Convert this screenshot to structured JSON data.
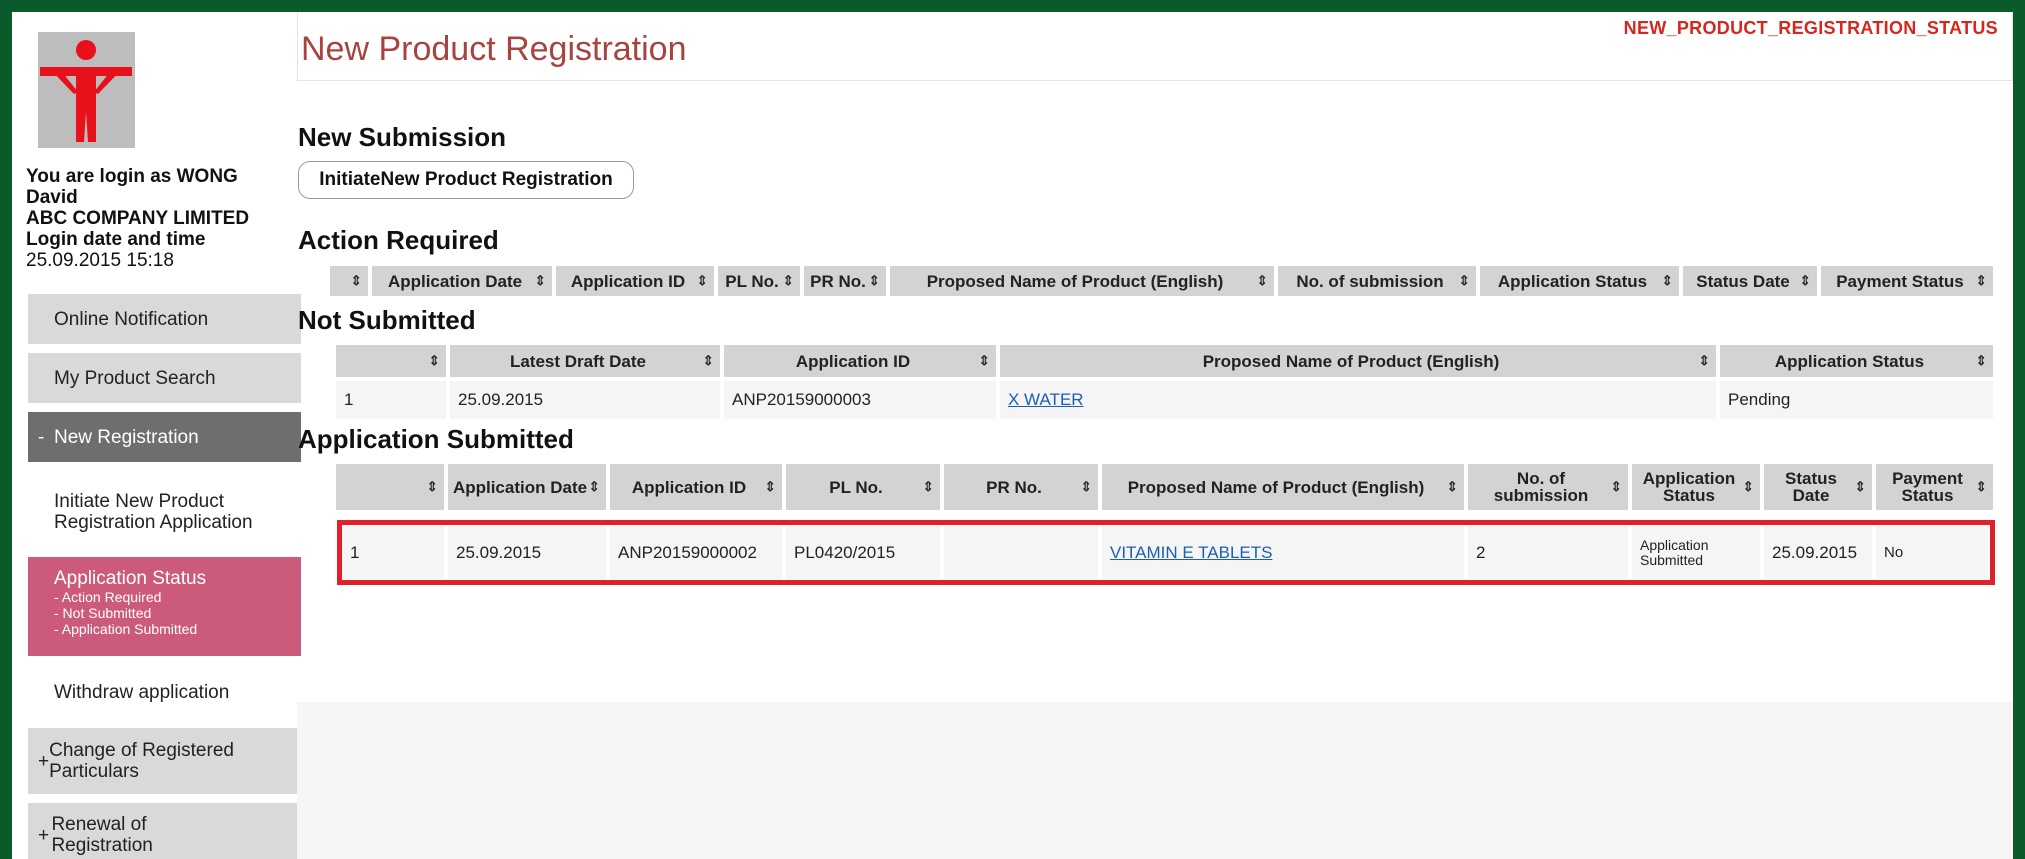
{
  "header": {
    "title": "New Product Registration",
    "code": "NEW_PRODUCT_REGISTRATION_STATUS"
  },
  "user": {
    "login_line1": "You are login as WONG",
    "login_line2": "David",
    "company": "ABC COMPANY LIMITED",
    "datetime_label": "Login date and time",
    "datetime": "25.09.2015 15:18"
  },
  "sidebar": {
    "online_notification": "Online Notification",
    "product_search": "My Product Search",
    "new_registration": "New Registration",
    "initiate_application": "Initiate New Product Registration Application",
    "application_status": "Application Status",
    "status_sub": [
      "- Action Required",
      "- Not Submitted",
      "- Application Submitted"
    ],
    "withdraw": "Withdraw application",
    "change_particulars": "Change of Registered Particulars",
    "renewal": "Renewal of Registration"
  },
  "new_submission": {
    "title": "New Submission",
    "button": "InitiateNew Product Registration"
  },
  "action_required": {
    "title": "Action Required",
    "headers": [
      "",
      "Application Date",
      "Application ID",
      "PL No.",
      "PR No.",
      "Proposed Name of Product (English)",
      "No. of submission",
      "Application Status",
      "Status Date",
      "Payment Status"
    ]
  },
  "not_submitted": {
    "title": "Not Submitted",
    "headers": [
      "",
      "Latest Draft Date",
      "Application ID",
      "Proposed Name of Product (English)",
      "Application Status"
    ],
    "rows": [
      {
        "no": "1",
        "date": "25.09.2015",
        "id": "ANP20159000003",
        "name": "X WATER",
        "status": "Pending"
      }
    ]
  },
  "application_submitted": {
    "title": "Application Submitted",
    "headers": [
      "",
      "Application Date",
      "Application ID",
      "PL No.",
      "PR No.",
      "Proposed Name of Product (English)",
      "No. of submission",
      "Application Status",
      "Status Date",
      "Payment Status"
    ],
    "rows": [
      {
        "no": "1",
        "date": "25.09.2015",
        "id": "ANP20159000002",
        "pl": "PL0420/2015",
        "pr": "",
        "name": "VITAMIN E TABLETS",
        "submissions": "2",
        "status": "Application Submitted",
        "status_date": "25.09.2015",
        "payment": "No"
      }
    ]
  },
  "colors": {
    "frame": "#0b5a2c",
    "title_red": "#a64540",
    "code_red": "#d7261e",
    "active_pink": "#cc5b7b",
    "highlight": "#e0202a",
    "link": "#1a5fb4"
  },
  "sort_icon": "updown-arrows-icon"
}
